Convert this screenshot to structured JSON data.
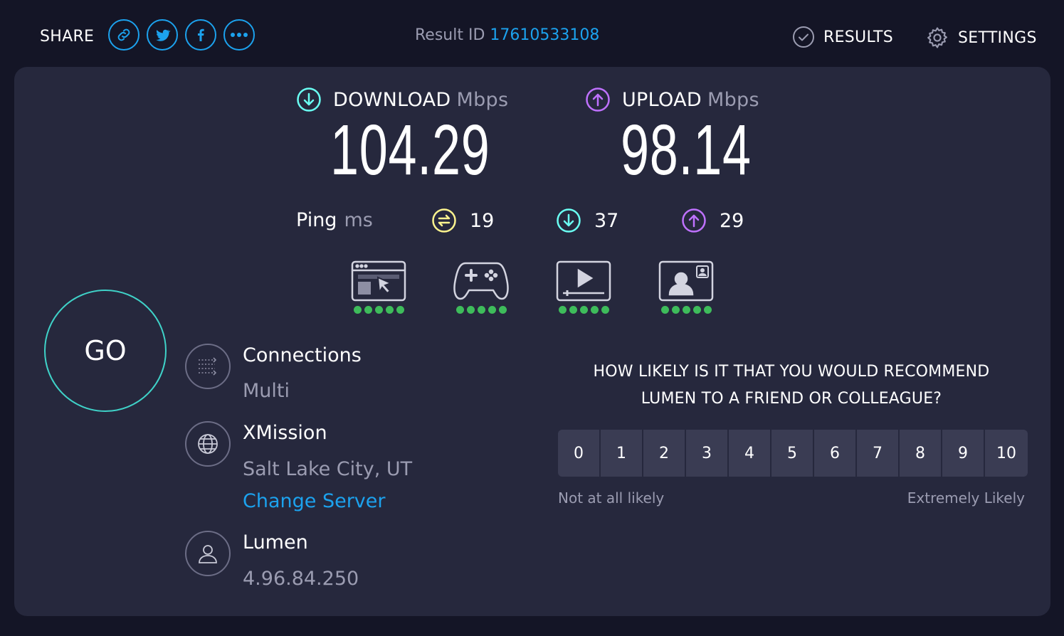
{
  "header": {
    "share_label": "SHARE",
    "share_buttons": [
      {
        "icon": "link-icon"
      },
      {
        "icon": "twitter-icon"
      },
      {
        "icon": "facebook-icon"
      },
      {
        "icon": "more-icon"
      }
    ],
    "result_id_label": "Result ID",
    "result_id": "17610533108",
    "results_label": "RESULTS",
    "settings_label": "SETTINGS"
  },
  "speeds": {
    "download": {
      "label": "DOWNLOAD",
      "unit": "Mbps",
      "value": "104.29"
    },
    "upload": {
      "label": "UPLOAD",
      "unit": "Mbps",
      "value": "98.14"
    }
  },
  "ping": {
    "label": "Ping",
    "unit": "ms",
    "idle": "19",
    "download": "37",
    "upload": "29"
  },
  "activities": [
    {
      "icon": "web-browsing-icon",
      "rating": 5
    },
    {
      "icon": "gaming-icon",
      "rating": 5
    },
    {
      "icon": "video-streaming-icon",
      "rating": 5
    },
    {
      "icon": "video-call-icon",
      "rating": 5
    }
  ],
  "go_label": "GO",
  "connections": {
    "title": "Connections",
    "value": "Multi"
  },
  "server": {
    "name": "XMission",
    "location": "Salt Lake City, UT",
    "change_label": "Change Server"
  },
  "isp": {
    "name": "Lumen",
    "ip": "4.96.84.250"
  },
  "survey": {
    "question_line1": "HOW LIKELY IS IT THAT YOU WOULD RECOMMEND",
    "question_line2": "LUMEN TO A FRIEND OR COLLEAGUE?",
    "scale": [
      "0",
      "1",
      "2",
      "3",
      "4",
      "5",
      "6",
      "7",
      "8",
      "9",
      "10"
    ],
    "low_label": "Not at all likely",
    "high_label": "Extremely Likely"
  },
  "colors": {
    "background": "#141526",
    "card": "#26283d",
    "accent_blue": "#1ca2ee",
    "download": "#6afff3",
    "upload": "#bf71ff",
    "ping_idle": "#fbf38e",
    "go_ring": "#3fd2c8",
    "rating_dot": "#3ebc5b"
  }
}
